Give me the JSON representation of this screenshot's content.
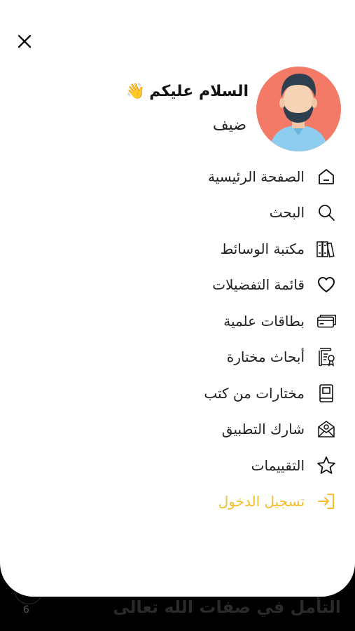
{
  "drawer": {
    "greeting": "السلام عليكم",
    "greeting_emoji": "👋",
    "username": "ضيف",
    "menu": [
      {
        "label": "الصفحة الرئيسية",
        "icon": "home-icon"
      },
      {
        "label": "البحث",
        "icon": "search-icon"
      },
      {
        "label": "مكتبة الوسائط",
        "icon": "library-icon"
      },
      {
        "label": "قائمة التفضيلات",
        "icon": "heart-icon"
      },
      {
        "label": "بطاقات علمية",
        "icon": "card-icon"
      },
      {
        "label": "أبحاث مختارة",
        "icon": "scroll-icon"
      },
      {
        "label": "مختارات من كتب",
        "icon": "book-icon"
      },
      {
        "label": "شارك التطبيق",
        "icon": "share-icon"
      },
      {
        "label": "التقييمات",
        "icon": "star-icon"
      },
      {
        "label": "تسجيل الدخول",
        "icon": "login-icon"
      }
    ]
  },
  "background": {
    "title": "التأمل في صفات الله تعالى",
    "page_number": "6"
  },
  "colors": {
    "accent": "#f2be2e",
    "avatar_bg": "#f37a67",
    "text": "#222222"
  }
}
